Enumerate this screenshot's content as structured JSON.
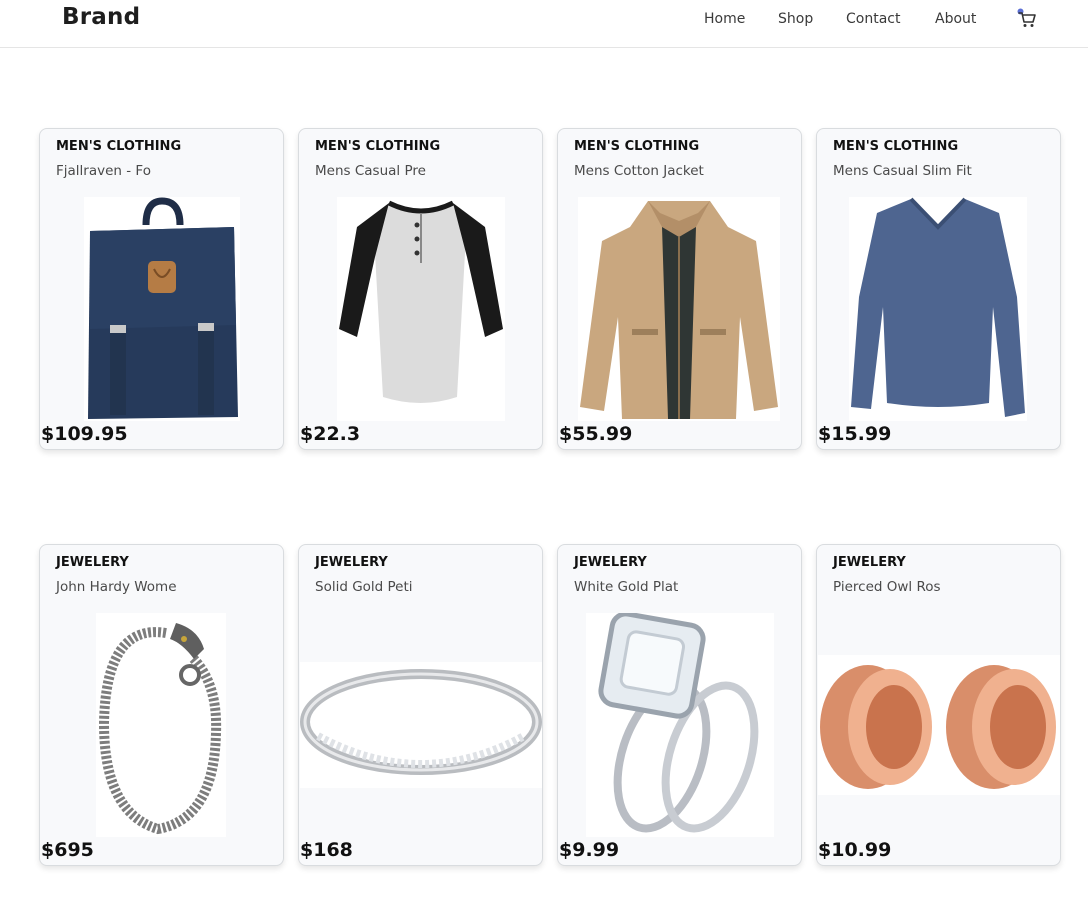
{
  "header": {
    "brand": "Brand",
    "nav": [
      "Home",
      "Shop",
      "Contact",
      "About"
    ],
    "cart_icon": "cart-icon"
  },
  "products": [
    {
      "category": "MEN'S CLOTHING",
      "title": "Fjallraven - Fo",
      "price": "$109.95",
      "image": "backpack"
    },
    {
      "category": "MEN'S CLOTHING",
      "title": "Mens Casual Pre",
      "price": "$22.3",
      "image": "raglan-tshirt"
    },
    {
      "category": "MEN'S CLOTHING",
      "title": "Mens Cotton Jacket",
      "price": "$55.99",
      "image": "jacket"
    },
    {
      "category": "MEN'S CLOTHING",
      "title": "Mens Casual Slim Fit",
      "price": "$15.99",
      "image": "longsleeve-shirt"
    },
    {
      "category": "JEWELERY",
      "title": "John Hardy Wome",
      "price": "$695",
      "image": "dragon-bracelet"
    },
    {
      "category": "JEWELERY",
      "title": "Solid Gold Peti",
      "price": "$168",
      "image": "silver-ring"
    },
    {
      "category": "JEWELERY",
      "title": "White Gold Plat",
      "price": "$9.99",
      "image": "diamond-ring-set"
    },
    {
      "category": "JEWELERY",
      "title": "Pierced Owl Ros",
      "price": "$10.99",
      "image": "rose-gold-plugs"
    }
  ]
}
